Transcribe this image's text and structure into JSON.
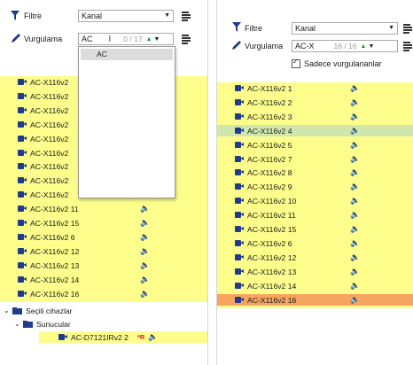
{
  "left": {
    "filter_label": "Filtre",
    "filter_value": "Kanal",
    "highlight_label": "Vurgulama",
    "highlight_input": "AC",
    "highlight_count": "0 / 17",
    "dropdown_options": [
      "AC"
    ],
    "list_rows": [
      {
        "name": "AC-X116v2",
        "speaker": true
      },
      {
        "name": "AC-X116v2",
        "speaker": true
      },
      {
        "name": "AC-X116v2",
        "speaker": true
      },
      {
        "name": "AC-X116v2",
        "speaker": true
      },
      {
        "name": "AC-X116v2",
        "speaker": true
      },
      {
        "name": "AC-X116v2",
        "speaker": true
      },
      {
        "name": "AC-X116v2",
        "speaker": true
      },
      {
        "name": "AC-X116v2",
        "speaker": true
      },
      {
        "name": "AC-X116v2",
        "speaker": true
      },
      {
        "name": "AC-X116v2 11",
        "speaker": true
      },
      {
        "name": "AC-X116v2 15",
        "speaker": true
      },
      {
        "name": "AC-X116v2 6",
        "speaker": true
      },
      {
        "name": "AC-X116v2 12",
        "speaker": true
      },
      {
        "name": "AC-X116v2 13",
        "speaker": true
      },
      {
        "name": "AC-X116v2 14",
        "speaker": true
      },
      {
        "name": "AC-X116v2 16",
        "speaker": true
      }
    ],
    "tree": {
      "group_label": "Seçili cihazlar",
      "sub_label": "Sunucular",
      "device_name": "AC-D7121IRv2 2",
      "device_badge": "*R"
    }
  },
  "right": {
    "filter_label": "Filtre",
    "filter_value": "Kanal",
    "highlight_label": "Vurgulama",
    "highlight_input": "AC-X",
    "highlight_count": "16 / 16",
    "checkbox_label": "Sadece vurgulananlar",
    "checkbox_checked": true,
    "list_rows": [
      {
        "name": "AC-X116v2 1",
        "state": "highlight"
      },
      {
        "name": "AC-X116v2 2",
        "state": "highlight"
      },
      {
        "name": "AC-X116v2 3",
        "state": "highlight"
      },
      {
        "name": "AC-X116v2 4",
        "state": "current"
      },
      {
        "name": "AC-X116v2 5",
        "state": "highlight"
      },
      {
        "name": "AC-X116v2 7",
        "state": "highlight"
      },
      {
        "name": "AC-X116v2 8",
        "state": "highlight"
      },
      {
        "name": "AC-X116v2 9",
        "state": "highlight"
      },
      {
        "name": "AC-X116v2 10",
        "state": "highlight"
      },
      {
        "name": "AC-X116v2 11",
        "state": "highlight"
      },
      {
        "name": "AC-X116v2 15",
        "state": "highlight"
      },
      {
        "name": "AC-X116v2 6",
        "state": "highlight"
      },
      {
        "name": "AC-X116v2 12",
        "state": "highlight"
      },
      {
        "name": "AC-X116v2 13",
        "state": "highlight"
      },
      {
        "name": "AC-X116v2 14",
        "state": "highlight"
      },
      {
        "name": "AC-X116v2 16",
        "state": "selected"
      }
    ]
  },
  "colors": {
    "highlight": "#fdfd8c",
    "current": "#cfe7ad",
    "selected": "#f7a460",
    "camera": "#1f3b8a"
  },
  "icons": {
    "filter": "filter-funnel-icon",
    "highlight": "pen-icon",
    "menu": "list-menu-icon",
    "camera": "camera-icon",
    "speaker": "speaker-icon",
    "folder": "folder-icon"
  }
}
